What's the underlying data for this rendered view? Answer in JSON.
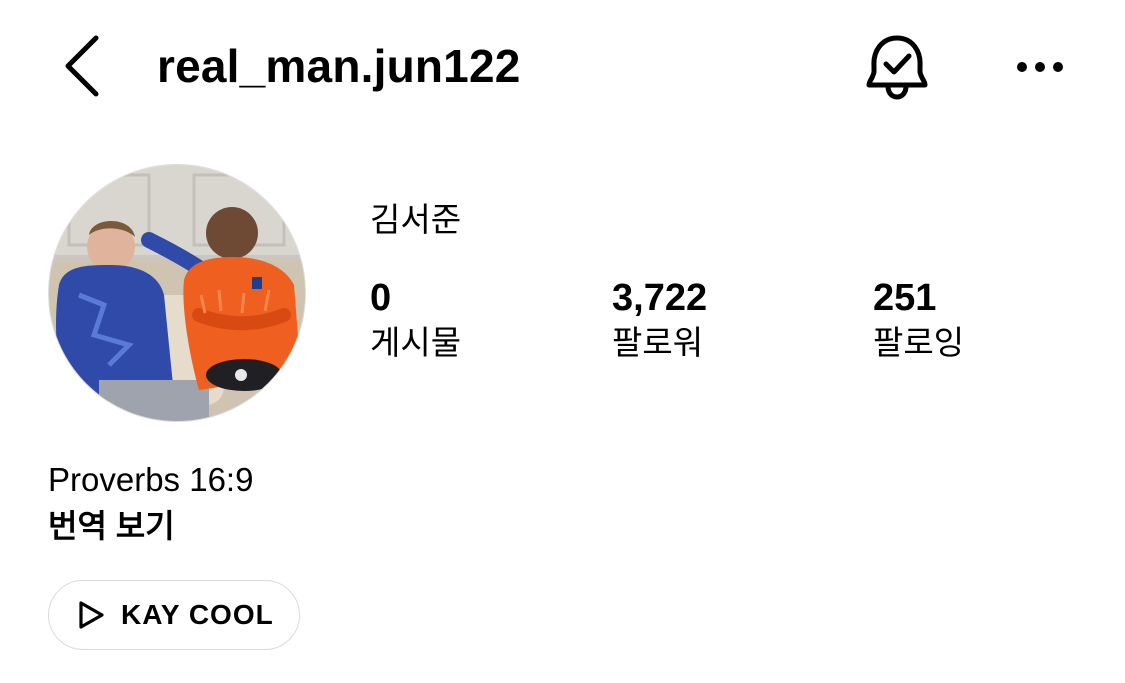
{
  "header": {
    "back_icon": "chevron-left-icon",
    "username": "real_man.jun122",
    "notification_icon": "bell-check-icon",
    "more_icon": "more-horizontal-icon"
  },
  "profile": {
    "avatar_description_icon": "profile-photo",
    "display_name": "김서준",
    "stats": {
      "posts": {
        "count": "0",
        "label": "게시물"
      },
      "followers": {
        "count": "3,722",
        "label": "팔로워"
      },
      "following": {
        "count": "251",
        "label": "팔로잉"
      }
    },
    "bio": "Proverbs 16:9",
    "translate_label": "번역 보기",
    "link": {
      "icon": "play-icon",
      "label": "KAY COOL"
    }
  }
}
